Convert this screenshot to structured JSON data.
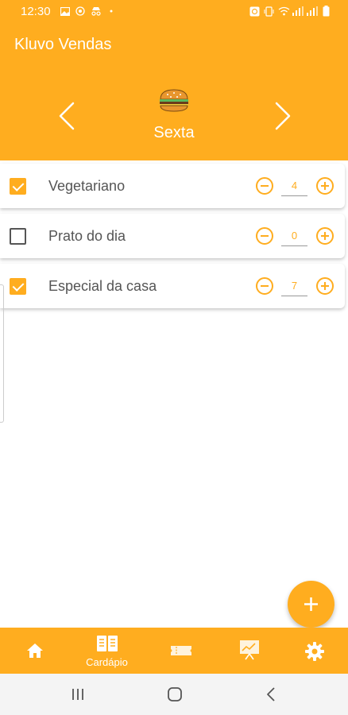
{
  "status_bar": {
    "time": "12:30",
    "left_icons": [
      "image-icon",
      "whatsapp-icon",
      "incognito-icon",
      "dot-icon"
    ],
    "right_icons": [
      "alarm-icon",
      "vibrate-icon",
      "wifi-icon",
      "signal-icon",
      "battery-icon"
    ]
  },
  "app_bar": {
    "title": "Kluvo Vendas",
    "day": "Sexta",
    "day_icon": "burger-icon"
  },
  "items": [
    {
      "label": "Vegetariano",
      "checked": true,
      "quantity": "4"
    },
    {
      "label": "Prato do dia",
      "checked": false,
      "quantity": "0"
    },
    {
      "label": "Especial da casa",
      "checked": true,
      "quantity": "7"
    }
  ],
  "fab": {
    "icon": "plus-icon"
  },
  "bottom_nav": {
    "items": [
      {
        "icon": "home-icon",
        "label": ""
      },
      {
        "icon": "menu-book-icon",
        "label": "Cardápio"
      },
      {
        "icon": "ticket-icon",
        "label": ""
      },
      {
        "icon": "presentation-chart-icon",
        "label": ""
      },
      {
        "icon": "gear-icon",
        "label": ""
      }
    ]
  },
  "colors": {
    "primary": "#FFAD1F",
    "text": "#555555",
    "system_nav_bg": "#F4F4F4"
  }
}
